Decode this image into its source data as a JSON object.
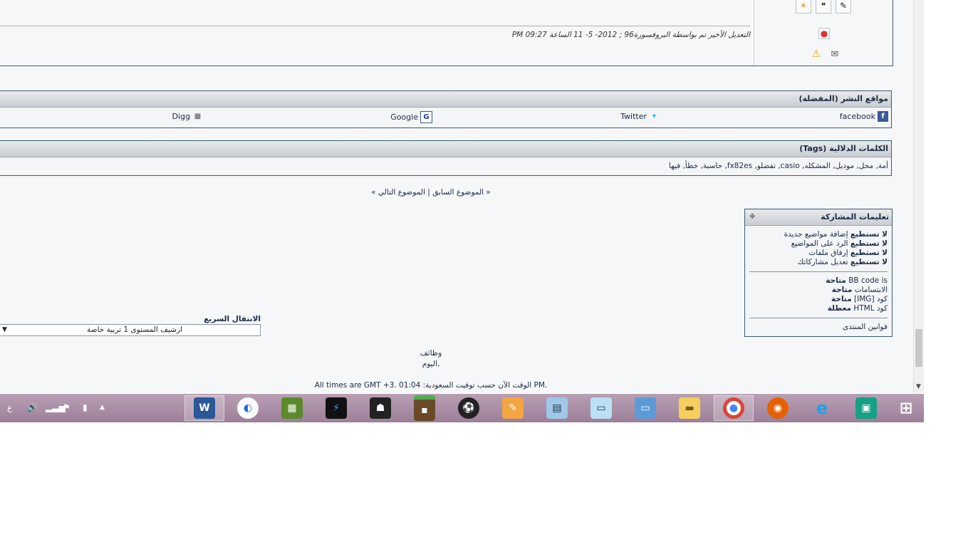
{
  "post": {
    "edit_note": "التعديل الأخير تم بواسطة البروفسورة96 ; 2012- 5- 11 الساعة 09:27 PM"
  },
  "social": {
    "title": "مواقع النشر (المفضلة)",
    "links": [
      {
        "label": "facebook",
        "icon": "facebook-icon"
      },
      {
        "label": "Twitter",
        "icon": "twitter-icon"
      },
      {
        "label": "Google",
        "icon": "google-icon"
      },
      {
        "label": "Digg",
        "icon": "digg-icon"
      }
    ]
  },
  "tags": {
    "title": "الكلمات الدلالية (Tags)",
    "list": "أمة, محل, موديل, المشكله, casio, تفضلو, fx82es, حاسبة, خطأ, فيها"
  },
  "thread_nav": {
    "prev": "« الموضوع السابق",
    "sep": " | ",
    "next": "الموضوع التالي »"
  },
  "permissions": {
    "title": "تعليمات المشاركة",
    "items": [
      {
        "strong": "لا تستطيع",
        "text": "إضافة مواضيع جديدة"
      },
      {
        "strong": "لا تستطيع",
        "text": "الرد على المواضيع"
      },
      {
        "strong": "لا تستطيع",
        "text": "إرفاق ملفات"
      },
      {
        "strong": "لا تستطيع",
        "text": "تعديل مشاركاتك"
      }
    ],
    "codes": [
      {
        "label": "BB code is",
        "state": "متاحة"
      },
      {
        "label": "الابتسامات",
        "state": "متاحة"
      },
      {
        "label": "كود [IMG]",
        "state": "متاحة"
      },
      {
        "label": "كود HTML",
        "state": "معطلة"
      }
    ],
    "rules_link": "قوانين المنتدى"
  },
  "quick_nav": {
    "label": "الانتقال السريع",
    "selected": "ارشيف المستوى 1 تربية خاصة"
  },
  "footer": {
    "line1": "وظائف",
    "line2": "اليوم,",
    "time_note": "All times are GMT +3. الوقت الآن حسب توقيت السعودية: 01:04 PM."
  },
  "taskbar": {
    "apps": [
      "word-icon",
      "browser-icon",
      "minecraft-icon",
      "game-icon",
      "assassin-icon",
      "grass-icon",
      "pes-icon",
      "paint-icon",
      "calculator-icon",
      "notepad-icon",
      "window-icon",
      "explorer-icon",
      "chrome-icon",
      "firefox-icon",
      "ie-icon",
      "store-icon",
      "start-icon"
    ],
    "language": "ع"
  }
}
